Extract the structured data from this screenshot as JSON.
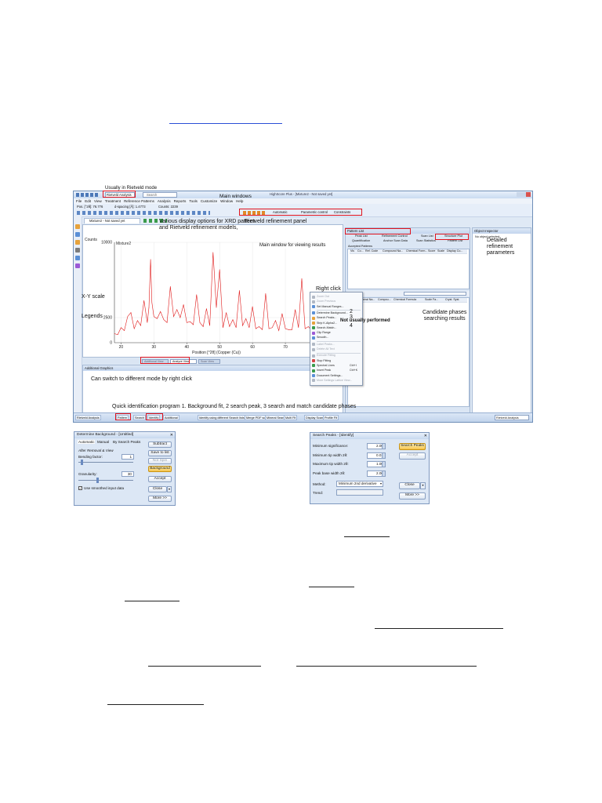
{
  "annotations": {
    "rietveld_mode": "Usually in Rietveld mode",
    "main_windows": "Main windows",
    "display_options": "Various display options for XRD pattern\nand Rietveld refinement models,",
    "rietveld_panel": "Rietveld refinement panel",
    "main_window_results": "Main window for viewing results",
    "xy_scale": "X-Y scale",
    "legends": "Legends",
    "right_click": "Right click",
    "not_usually": "Not usually performed",
    "candidate": "Candidate phases\nsearching results",
    "detailed": "Detailed\nrefinement\nparameters",
    "switch_mode": "Can switch to different mode by right click",
    "quick_id": "Quick identification program 1. Background fit, 2 search peak, 3 search and match candidate phases",
    "step2": "2",
    "step3": "3",
    "step4": "4"
  },
  "app": {
    "title": "HighScore Plus - [Mixture2 - Not saved yet]",
    "mode_selector": "Rietveld Analysis",
    "search_box": "Search",
    "menu": [
      "File",
      "Edit",
      "View",
      "Treatment",
      "Reference Patterns",
      "Analysis",
      "Reports",
      "Tools",
      "Customize",
      "Window",
      "Help"
    ],
    "status": {
      "pos": "Pos. [°2θ]: 76.776",
      "spacing": "d-spacing [Å]: 1.4773",
      "counts": "Counts: 2239"
    },
    "refine_toolbar": [
      "Automatic",
      "Parametric control",
      "Constraints"
    ],
    "doc_tab": "Mixture2 - Not saved yet",
    "chart_tab_buttons": [
      "Additional View",
      "Analyze View",
      "Scan View"
    ],
    "additional_graphics": "Additional Graphics",
    "pattern_list": {
      "title": "Pattern List",
      "tabs": [
        "Peak List",
        "Refinement Control",
        "Scan List",
        "Structure Plot"
      ],
      "tabs2": [
        "Quantification",
        "Anchor Scan Data",
        "Scan Statistics",
        "Pattern List"
      ],
      "accepted": "Accepted Patterns",
      "columns": [
        "Vis",
        "Co...",
        "Ref. Code",
        "Compound Na...",
        "Chemical Form...",
        "Score",
        "Scale",
        "Display Co..."
      ],
      "candidates_columns": [
        "Vis",
        "Mineral Na...",
        "Compou...",
        "Chemical Formula",
        "Scale Fa...",
        "Cryst. Syst."
      ]
    },
    "object_inspector": {
      "title": "Object Inspector",
      "text": "No object selected."
    },
    "taskbar": [
      "Rietveld Analysis",
      "Pattern",
      "Search",
      "Identify",
      "Additional",
      "Identify using different Search lists",
      "Merge PDF scans",
      "Mineral Search",
      "Multi Fit",
      "Display Scans",
      "Profile Fit"
    ],
    "task_mode": "Rietveld Analysis"
  },
  "chart_data": {
    "type": "line",
    "title": "Mixture2",
    "xlabel": "Position [°2θ] (Copper (Cu))",
    "ylabel": "Counts",
    "xlim": [
      18,
      80
    ],
    "ylim": [
      0,
      10000
    ],
    "xticks": [
      20,
      30,
      40,
      50,
      60,
      70
    ],
    "yticks": [
      0,
      2500,
      10000
    ],
    "grid": true,
    "series": [
      {
        "color": "#e01818",
        "x": [
          18,
          19,
          20,
          21,
          22,
          23,
          24,
          25,
          26,
          27,
          28,
          28.5,
          29,
          29.4,
          30,
          31,
          32,
          33,
          34,
          35,
          36,
          37,
          38,
          39,
          40,
          41,
          42,
          43,
          44,
          45,
          46,
          47,
          48,
          49,
          50,
          51,
          52,
          53,
          54,
          55,
          56,
          57,
          58,
          59,
          60,
          61,
          62,
          63,
          64,
          65,
          66,
          67,
          68,
          69,
          70,
          71,
          72,
          73,
          74,
          75,
          76,
          77,
          78,
          79,
          80
        ],
        "y": [
          900,
          800,
          1500,
          1200,
          2600,
          3000,
          1400,
          2200,
          1700,
          4200,
          2000,
          3500,
          8300,
          4000,
          2600,
          2400,
          3100,
          2300,
          2000,
          5600,
          2600,
          3300,
          2500,
          3800,
          2000,
          2100,
          1800,
          4800,
          2000,
          1600,
          3400,
          1700,
          9000,
          3500,
          7300,
          1500,
          3000,
          1600,
          2300,
          1500,
          5200,
          1700,
          2400,
          1500,
          3600,
          1400,
          1600,
          1300,
          4900,
          1400,
          1500,
          2200,
          1200,
          2900,
          1400,
          1300,
          1300,
          3300,
          1500,
          6400,
          1400,
          1600,
          1200,
          1100,
          1000
        ]
      }
    ]
  },
  "background_dialog": {
    "title": "Determine Background - [Untitled]",
    "tabs": [
      "Automatic",
      "Manual",
      "By Search Peaks"
    ],
    "section": "After Removal & View",
    "bending_label": "Bending factor:",
    "bending_value": "1",
    "granularity_label": "Granularity:",
    "granularity_value": "30",
    "use_smoothed": "Use smoothed input data",
    "buttons": {
      "subtract": "Subtract",
      "save": "Save to list",
      "not_spin": "Not Spin",
      "background": "Background",
      "accept": "Accept",
      "close": "Close",
      "more": "More >>"
    }
  },
  "search_dialog": {
    "title": "Search Peaks - [Identify]",
    "fields": [
      {
        "label": "Minimum significance:",
        "value": "2.00"
      },
      {
        "label": "Minimum tip width 2θ:",
        "value": "0.01"
      },
      {
        "label": "Maximum tip width 2θ:",
        "value": "1.00"
      },
      {
        "label": "Peak base width 2θ:",
        "value": "2.00"
      }
    ],
    "method_label": "Method:",
    "method_value": "Minimum 2nd derivative",
    "trend_label": "Trend:",
    "buttons": {
      "search": "Search Peaks",
      "accept": "Accept",
      "close": "Close",
      "more": "More >>"
    }
  },
  "context_menu": {
    "items": [
      "Zoom Out",
      "Zoom Previous",
      "Set Manual Ranges...",
      "Determine Background...",
      "Search Peaks...",
      "Strip K-Alpha2...",
      "Search-Match...",
      "Clip Range",
      "Smooth...",
      "Label Peaks...",
      "Delete All Text",
      "Execute Fitting",
      "Stop Fitting",
      "Spectral Lines",
      "Insert Peak",
      "Document Settings...",
      "More Settings Lattice View..."
    ],
    "shortcuts": [
      "",
      "",
      "",
      "",
      "",
      "",
      "",
      "",
      "",
      "",
      "",
      "",
      "",
      "Ctrl+I",
      "Ctrl+K",
      "",
      ""
    ]
  }
}
